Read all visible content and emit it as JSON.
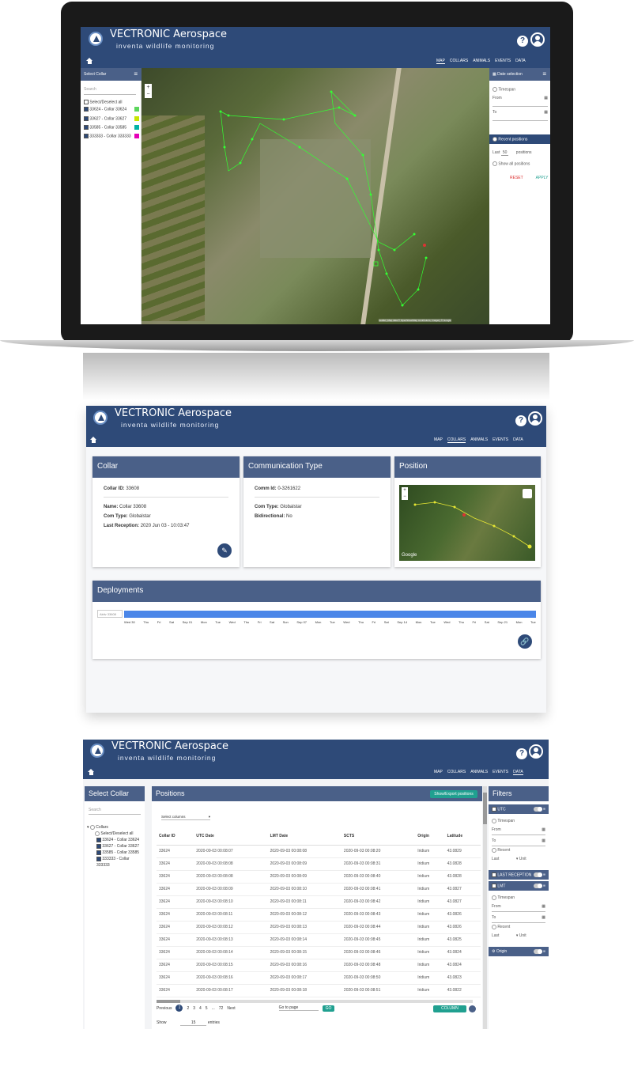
{
  "brand": {
    "title": "VECTRONIC Aerospace",
    "subtitle": "inventa wildlife monitoring",
    "help": "?"
  },
  "nav": {
    "map": "MAP",
    "collars": "COLLARS",
    "animals": "ANIMALS",
    "events": "EVENTS",
    "data": "DATA"
  },
  "s1": {
    "select_collar": "Select Collar",
    "search_placeholder": "Search",
    "select_all": "Select/Deselect all",
    "collars": [
      {
        "label": "33624 - Collar 33624",
        "color": "#5cd65c"
      },
      {
        "label": "33627 - Collar 33627",
        "color": "#c8e600"
      },
      {
        "label": "33585 - Collar 33585",
        "color": "#00b3a6"
      },
      {
        "label": "333333 - Collar 333333",
        "color": "#e600b8"
      }
    ],
    "date_selection": "Date selection",
    "timespan": "Timespan",
    "from": "From",
    "to": "To",
    "recent_positions": "Recent positions",
    "last": "Last",
    "last_value": "50",
    "positions": "positions",
    "show_all": "Show all positions",
    "reset": "RESET",
    "apply": "APPLY",
    "attribution": "Leaflet | Map data © OpenStreetMap contributors, Imagery © Google"
  },
  "s2": {
    "collar_title": "Collar",
    "collar_id_label": "Collar ID:",
    "collar_id": "33608",
    "name_label": "Name:",
    "name": "Collar 33608",
    "comtype_label": "Com Type:",
    "comtype": "Globalstar",
    "last_rec_label": "Last Reception:",
    "last_rec": "2020 Jun 03 - 10:03:47",
    "comm_title": "Communication Type",
    "comm_id_label": "Comm Id:",
    "comm_id": "0-3261622",
    "comm_type_label": "Com Type:",
    "comm_type": "Globalstar",
    "bidir_label": "Bidirectional:",
    "bidir": "No",
    "position_title": "Position",
    "google": "Google",
    "deploy_title": "Deployments",
    "deploy_label": "Aktiv 33608",
    "timeline": [
      "Wed 30",
      "Thu",
      "Fri",
      "Sat",
      "Sep 01",
      "Mon",
      "Tue",
      "Wed",
      "Thu",
      "Fri",
      "Sat",
      "Sun",
      "Sep 07",
      "Mon",
      "Tue",
      "Wed",
      "Thu",
      "Fri",
      "Sat",
      "Sep 14",
      "Mon",
      "Tue",
      "Wed",
      "Thu",
      "Fri",
      "Sat",
      "Sep 21",
      "Mon",
      "Tue"
    ]
  },
  "s3": {
    "select_collar": "Select Collar",
    "search_placeholder": "Search",
    "tree_root": "Collars",
    "select_all": "Select/Deselect all",
    "tree": [
      "33624 - Collar 33624",
      "33627 - Collar 33627",
      "33585 - Collar 33585",
      "333333 - Collar 333333"
    ],
    "positions_title": "Positions",
    "export_btn": "Show/Export positions",
    "select_columns": "Select columns",
    "columns": [
      "Collar ID",
      "UTC Date",
      "LMT Date",
      "SCTS",
      "Origin",
      "Latitude"
    ],
    "rows": [
      [
        "33624",
        "2020-09-03 00:08:07",
        "2020-09-03 00:08:08",
        "2020-09-03 00:08:20",
        "Iridium",
        "43.0829"
      ],
      [
        "33624",
        "2020-09-03 00:08:08",
        "2020-09-03 00:08:09",
        "2020-09-03 00:08:31",
        "Iridium",
        "43.0828"
      ],
      [
        "33624",
        "2020-09-03 00:08:08",
        "2020-09-03 00:08:09",
        "2020-09-03 00:08:40",
        "Iridium",
        "43.0828"
      ],
      [
        "33624",
        "2020-09-03 00:08:09",
        "2020-09-03 00:08:10",
        "2020-09-03 00:08:41",
        "Iridium",
        "43.0827"
      ],
      [
        "33624",
        "2020-09-03 00:08:10",
        "2020-09-03 00:08:11",
        "2020-09-03 00:08:42",
        "Iridium",
        "43.0827"
      ],
      [
        "33624",
        "2020-09-03 00:08:11",
        "2020-09-03 00:08:12",
        "2020-09-03 00:08:43",
        "Iridium",
        "43.0826"
      ],
      [
        "33624",
        "2020-09-03 00:08:12",
        "2020-09-03 00:08:13",
        "2020-09-03 00:08:44",
        "Iridium",
        "43.0826"
      ],
      [
        "33624",
        "2020-09-03 00:08:13",
        "2020-09-03 00:08:14",
        "2020-09-03 00:08:45",
        "Iridium",
        "43.0825"
      ],
      [
        "33624",
        "2020-09-03 00:08:14",
        "2020-09-03 00:08:15",
        "2020-09-03 00:08:46",
        "Iridium",
        "43.0824"
      ],
      [
        "33624",
        "2020-09-03 00:08:15",
        "2020-09-03 00:08:16",
        "2020-09-03 00:08:48",
        "Iridium",
        "43.0824"
      ],
      [
        "33624",
        "2020-09-03 00:08:16",
        "2020-09-03 00:08:17",
        "2020-09-03 00:08:50",
        "Iridium",
        "43.0823"
      ],
      [
        "33624",
        "2020-09-03 00:08:17",
        "2020-09-03 00:08:18",
        "2020-09-03 00:08:51",
        "Iridium",
        "43.0822"
      ]
    ],
    "pagination": {
      "prev": "Previous",
      "pages": [
        "1",
        "2",
        "3",
        "4",
        "5",
        "...",
        "72"
      ],
      "next": "Next",
      "goto": "Go to page",
      "go": "GO"
    },
    "show": "Show",
    "show_value": "15",
    "entries": "entries",
    "columns_btn": "COLUMN FILTERS",
    "filters_title": "Filters",
    "utc": "UTC",
    "timespan": "Timespan",
    "from": "From",
    "to": "To",
    "recent": "Recent",
    "last": "Last",
    "unit": "Unit",
    "last_reception": "LAST RECEPTION",
    "lmt": "LMT",
    "timespan2": "Timespan",
    "from2": "From",
    "to2": "To",
    "recent2": "Recent",
    "last2": "Last",
    "unit2": "Unit",
    "origin": "Origin"
  }
}
